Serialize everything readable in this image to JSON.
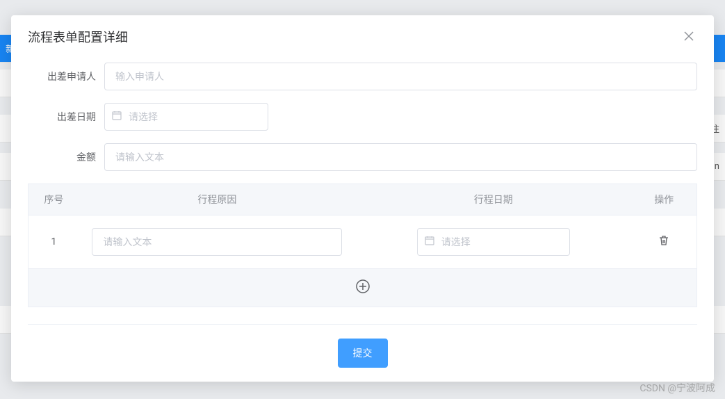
{
  "modal": {
    "title": "流程表单配置详细"
  },
  "form": {
    "applicant": {
      "label": "出差申请人",
      "placeholder": "输入申请人"
    },
    "date": {
      "label": "出差日期",
      "placeholder": "请选择"
    },
    "amount": {
      "label": "金额",
      "placeholder": "请输入文本"
    }
  },
  "table": {
    "headers": {
      "seq": "序号",
      "reason": "行程原因",
      "date": "行程日期",
      "action": "操作"
    },
    "rows": [
      {
        "seq": "1",
        "reason_placeholder": "请输入文本",
        "date_placeholder": "请选择"
      }
    ]
  },
  "footer": {
    "submit": "提交"
  },
  "background": {
    "btn_new": "新增",
    "text_note": "注",
    "text_sign": "sign"
  },
  "watermark": "CSDN @宁波阿成"
}
